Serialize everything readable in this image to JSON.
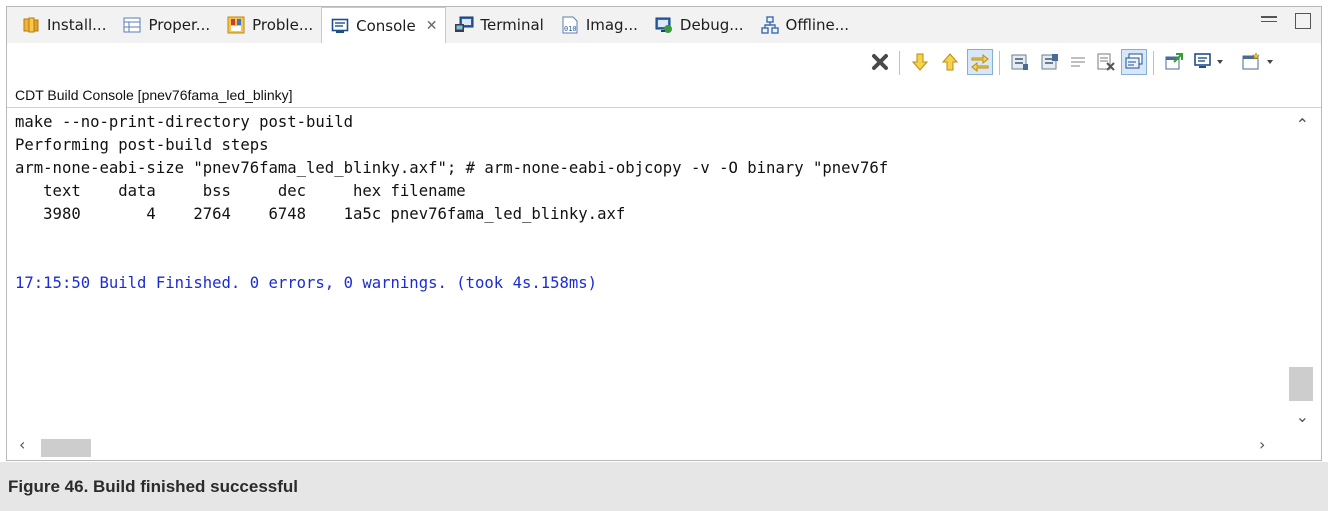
{
  "tabs": [
    {
      "label": "Install...",
      "icon": "install-icon"
    },
    {
      "label": "Proper...",
      "icon": "properties-icon"
    },
    {
      "label": "Proble...",
      "icon": "problems-icon"
    },
    {
      "label": "Console",
      "icon": "console-icon",
      "active": true,
      "close": "✕"
    },
    {
      "label": "Terminal",
      "icon": "terminal-icon"
    },
    {
      "label": "Imag...",
      "icon": "image-info-icon"
    },
    {
      "label": "Debug...",
      "icon": "debugger-console-icon"
    },
    {
      "label": "Offline...",
      "icon": "offline-config-icon"
    }
  ],
  "console": {
    "title": "CDT Build Console [pnev76fama_led_blinky]",
    "lines": [
      "make --no-print-directory post-build",
      "Performing post-build steps",
      "arm-none-eabi-size \"pnev76fama_led_blinky.axf\"; # arm-none-eabi-objcopy -v -O binary \"pnev76f",
      "   text    data     bss     dec     hex filename",
      "   3980       4    2764    6748    1a5c pnev76fama_led_blinky.axf",
      "",
      "",
      ""
    ],
    "finished_line": "17:15:50 Build Finished. 0 errors, 0 warnings. (took 4s.158ms)"
  },
  "caption": "Figure 46.  Build finished successful",
  "colors": {
    "accent": "#1c2cd4",
    "caption_bg": "#e6e6e6"
  }
}
